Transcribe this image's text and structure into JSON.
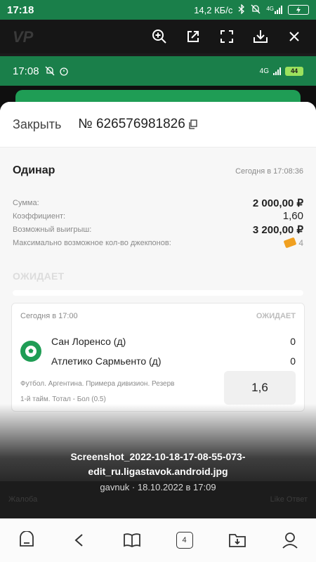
{
  "status_bar": {
    "time": "17:18",
    "net_speed": "14,2 КБ/с",
    "network": "4G",
    "battery": "",
    "icons": [
      "bluetooth-icon",
      "bell-off-icon",
      "signal-icon",
      "battery-charging-icon"
    ]
  },
  "viewer_toolbar": {
    "background_hint": "VP",
    "tools": [
      "zoom-in-icon",
      "open-external-icon",
      "fullscreen-icon",
      "download-icon",
      "close-icon"
    ]
  },
  "inner_status": {
    "time": "17:08",
    "network": "4G",
    "battery": "44"
  },
  "bet_sheet": {
    "close_label": "Закрыть",
    "bet_number": "№ 626576981826",
    "type": "Одинар",
    "placed_at": "Сегодня в 17:08:36",
    "rows": [
      {
        "label": "Сумма:",
        "value": "2 000,00 ₽"
      },
      {
        "label": "Коэффициент:",
        "value": "1,60"
      },
      {
        "label": "Возможный выигрыш:",
        "value": "3 200,00 ₽"
      }
    ],
    "jackpot_label": "Максимально возможное кол-во джекпонов:",
    "jackpot_value": "4",
    "status": "ОЖИДАЕТ"
  },
  "event": {
    "time": "Сегодня в 17:00",
    "status": "ОЖИДАЕТ",
    "team1": "Сан Лоренсо (д)",
    "score1": "0",
    "team2": "Атлетико Сармьенто (д)",
    "score2": "0",
    "league": "Футбол. Аргентина. Примера дивизион. Резерв",
    "market": "1-й тайм. Тотал - Бол (0.5)",
    "coefficient": "1,6"
  },
  "caption": {
    "line1": "Screenshot_2022-10-18-17-08-55-073-",
    "line2": "edit_ru.ligastavok.android.jpg",
    "meta": "gavnuk · 18.10.2022 в 17:09",
    "below_left": "Жалоба",
    "below_right": "Like  Ответ"
  },
  "bottom_nav": {
    "tabs_count": "4",
    "items": [
      "home-icon",
      "back-icon",
      "bookmarks-icon",
      "tabs-icon",
      "downloads-icon",
      "profile-icon"
    ]
  }
}
